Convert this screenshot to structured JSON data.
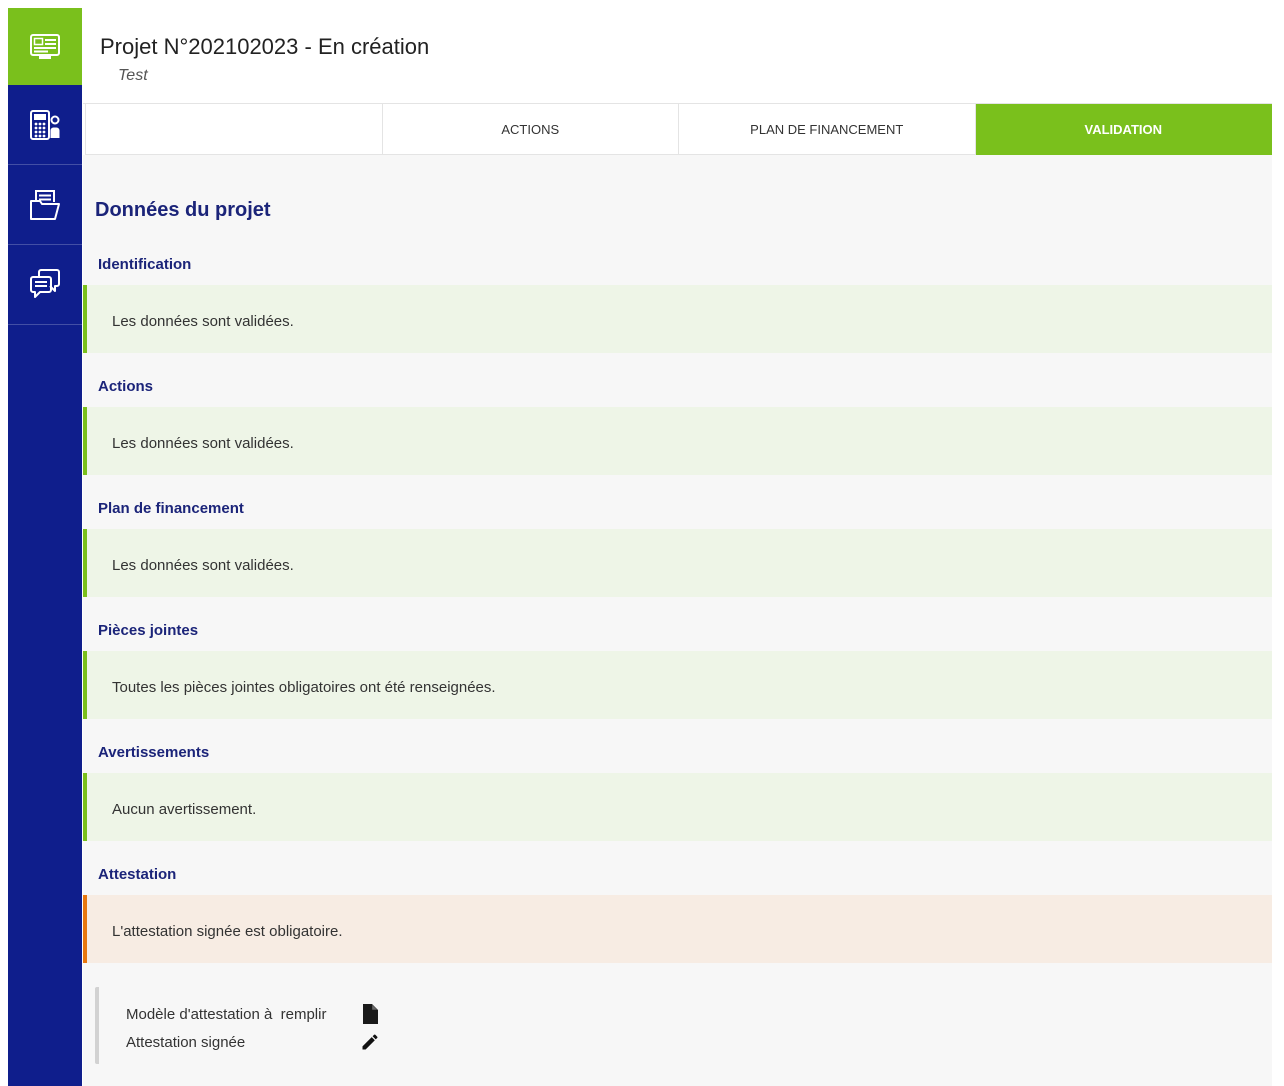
{
  "colors": {
    "sidebar": "#0f1e8c",
    "accent": "#7ac01c",
    "heading": "#1b2479",
    "text": "#333333"
  },
  "sidebar": {
    "items": [
      {
        "icon": "project-card-icon",
        "active": true
      },
      {
        "icon": "calculator-user-icon",
        "active": false
      },
      {
        "icon": "folder-document-icon",
        "active": false
      },
      {
        "icon": "chat-bubbles-icon",
        "active": false
      }
    ]
  },
  "header": {
    "title": "Projet N°202102023 - En création",
    "subtitle": "Test"
  },
  "tabs": [
    {
      "label": "",
      "active": false
    },
    {
      "label": "ACTIONS",
      "active": false
    },
    {
      "label": "PLAN DE FINANCEMENT",
      "active": false
    },
    {
      "label": "VALIDATION",
      "active": true
    }
  ],
  "content": {
    "heading": "Données du projet",
    "sections": [
      {
        "label": "Identification",
        "message": "Les données sont validées.",
        "bar_color": "#7ac01c",
        "bg_color": "#eef5e7"
      },
      {
        "label": "Actions",
        "message": "Les données sont validées.",
        "bar_color": "#7ac01c",
        "bg_color": "#eef5e7"
      },
      {
        "label": "Plan de financement",
        "message": "Les données sont validées.",
        "bar_color": "#7ac01c",
        "bg_color": "#eef5e7"
      },
      {
        "label": "Pièces jointes",
        "message": "Toutes les pièces jointes obligatoires ont été renseignées.",
        "bar_color": "#7ac01c",
        "bg_color": "#eef5e7"
      },
      {
        "label": "Avertissements",
        "message": "Aucun avertissement.",
        "bar_color": "#7ac01c",
        "bg_color": "#eef5e7"
      },
      {
        "label": "Attestation",
        "message": "L'attestation signée est obligatoire.",
        "bar_color": "#e8770f",
        "bg_color": "#f7ece3"
      }
    ],
    "attestation_links": {
      "template_label": "Modèle d'attestation à  remplir",
      "template_icon": "file-icon",
      "signed_label": "Attestation signée",
      "signed_icon": "pencil-icon"
    }
  }
}
